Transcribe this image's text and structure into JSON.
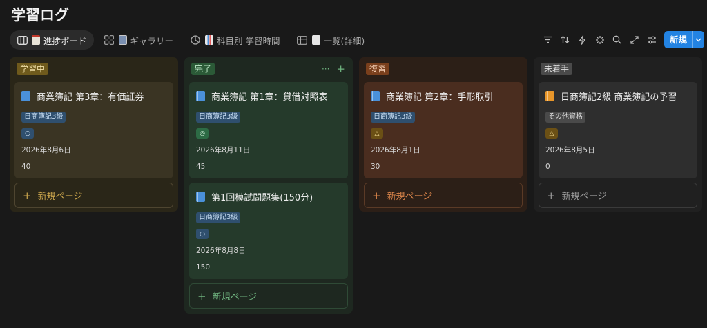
{
  "page": {
    "title": "学習ログ"
  },
  "views": [
    {
      "label": "進捗ボード",
      "active": true
    },
    {
      "label": "ギャラリー",
      "active": false
    },
    {
      "label": "科目別 学習時間",
      "active": false
    },
    {
      "label": "一覧(詳細)",
      "active": false
    }
  ],
  "toolbar": {
    "icons": [
      "filter-icon",
      "sort-icon",
      "automation-icon",
      "ai-sparkle-icon",
      "search-icon",
      "expand-icon",
      "settings-icon"
    ],
    "new_label": "新規"
  },
  "columns": [
    {
      "status": "学習中",
      "cards": [
        {
          "title": "商業簿記 第3章：有価証券",
          "tag": "日商簿記3級",
          "mark": "○",
          "date": "2026年8月6日",
          "minutes": "40"
        }
      ],
      "new_page": "新規ページ"
    },
    {
      "status": "完了",
      "actions": [
        "···",
        "+"
      ],
      "cards": [
        {
          "title": "商業簿記 第1章：貸借対照表",
          "tag": "日商簿記3級",
          "mark": "◎",
          "date": "2026年8月11日",
          "minutes": "45"
        },
        {
          "title": "第1回模試問題集(150分)",
          "tag": "日商簿記3級",
          "mark": "○",
          "date": "2026年8月8日",
          "minutes": "150"
        }
      ],
      "new_page": "新規ページ"
    },
    {
      "status": "復習",
      "cards": [
        {
          "title": "商業簿記 第2章：手形取引",
          "tag": "日商簿記3級",
          "mark": "△",
          "date": "2026年8月1日",
          "minutes": "30"
        }
      ],
      "new_page": "新規ページ"
    },
    {
      "status": "未着手",
      "cards": [
        {
          "title": "日商簿記2級 商業簿記の予習",
          "tag": "その他資格",
          "mark": "△",
          "date": "2026年8月5日",
          "minutes": "0"
        }
      ],
      "new_page": "新規ページ"
    }
  ],
  "colors": {
    "accent": "#2383e2",
    "learning": "#6f5a1c",
    "done": "#2b5a37",
    "review": "#7a3f1c",
    "todo": "#4a4a4a"
  }
}
